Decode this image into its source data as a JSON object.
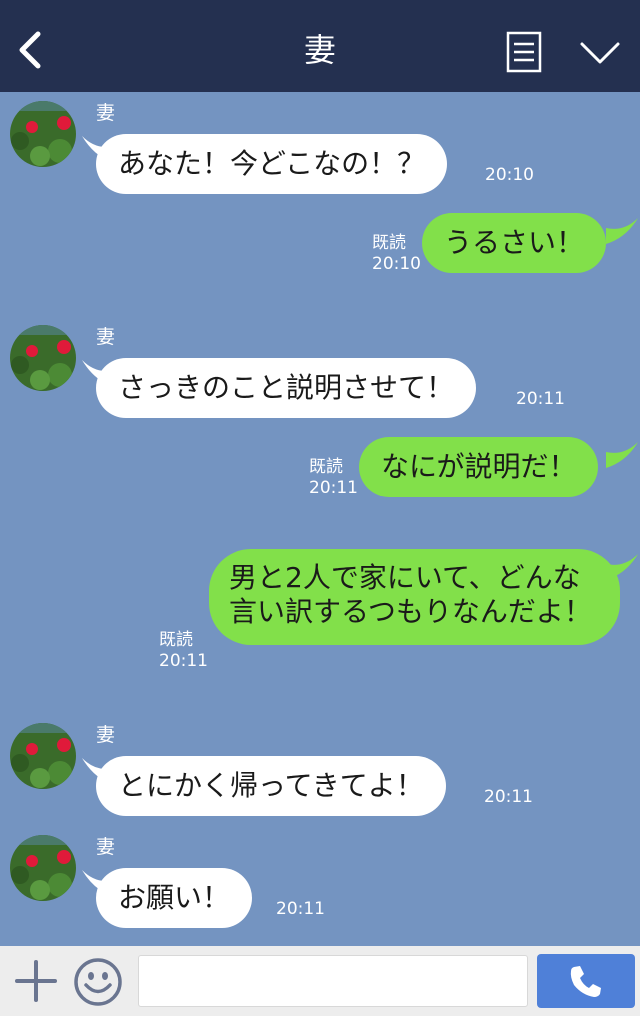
{
  "header": {
    "title": "妻",
    "back_icon": "chevron-left-icon",
    "menu_icon": "document-menu-icon",
    "collapse_icon": "chevron-down-icon",
    "bg_color": "#243050"
  },
  "chat": {
    "bg_color": "#7494c1",
    "incoming_bubble_color": "#ffffff",
    "outgoing_bubble_color": "#82e04a",
    "messages": [
      {
        "direction": "in",
        "sender": "妻",
        "text": "あなた！今どこなの！？",
        "time": "20:10"
      },
      {
        "direction": "out",
        "read_label": "既読",
        "text": "うるさい！",
        "time": "20:10"
      },
      {
        "direction": "in",
        "sender": "妻",
        "text": "さっきのこと説明させて！",
        "time": "20:11"
      },
      {
        "direction": "out",
        "read_label": "既読",
        "text": "なにが説明だ！",
        "time": "20:11"
      },
      {
        "direction": "out",
        "read_label": "既読",
        "text": "男と2人で家にいて、どんな言い訳するつもりなんだよ！",
        "time": "20:11"
      },
      {
        "direction": "in",
        "sender": "妻",
        "text": "とにかく帰ってきてよ！",
        "time": "20:11"
      },
      {
        "direction": "in",
        "sender": "妻",
        "text": "お願い！",
        "time": "20:11"
      }
    ]
  },
  "input_bar": {
    "plus_icon": "plus-icon",
    "emoji_icon": "smiley-face-icon",
    "message_placeholder": "",
    "call_icon": "phone-icon",
    "call_button_color": "#4f80d8"
  }
}
